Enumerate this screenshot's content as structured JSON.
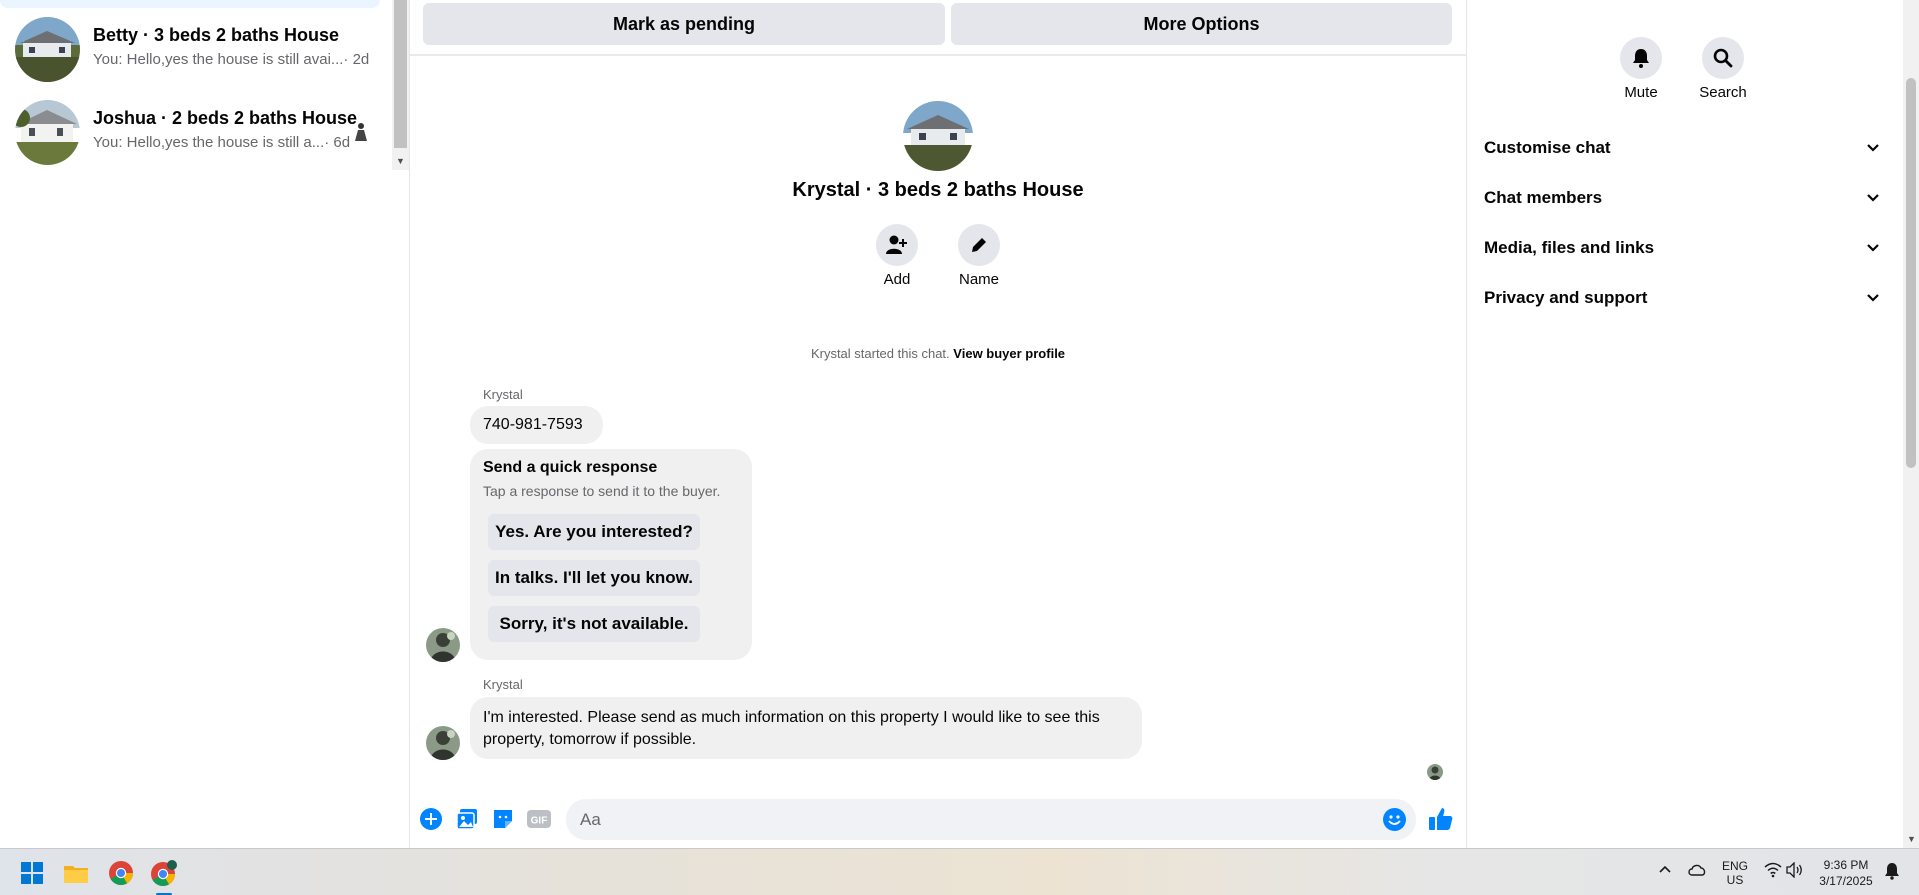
{
  "conversations": [
    {
      "title": "Betty · 3 beds 2 baths House",
      "preview": "You: Hello,yes the house is still avai...",
      "time": "· 2d"
    },
    {
      "title": "Joshua · 2 beds 2 baths House",
      "preview": "You: Hello,yes the house is still a...",
      "time": "· 6d"
    }
  ],
  "toolbar": {
    "pending_label": "Mark as pending",
    "more_label": "More Options"
  },
  "chat": {
    "title": "Krystal · 3 beds 2 baths House",
    "add_label": "Add",
    "name_label": "Name",
    "started_text": "Krystal started this chat.",
    "view_profile": "View buyer profile",
    "messages": [
      {
        "sender": "Krystal",
        "text": "740-981-7593"
      },
      {
        "sender": "Krystal",
        "text": "I'm interested. Please send as much information on this property I would like to see this property, tomorrow if possible."
      }
    ],
    "quick_response": {
      "title": "Send a quick response",
      "subtitle": "Tap a response to send it to the buyer.",
      "options": [
        "Yes. Are you interested?",
        "In talks. I'll let you know.",
        "Sorry, it's not available."
      ]
    }
  },
  "composer": {
    "placeholder": "Aa"
  },
  "right_panel": {
    "mute_label": "Mute",
    "search_label": "Search",
    "sections": [
      "Customise chat",
      "Chat members",
      "Media, files and links",
      "Privacy and support"
    ]
  },
  "taskbar": {
    "lang1": "ENG",
    "lang2": "US",
    "time": "9:36 PM",
    "date": "3/17/2025"
  },
  "colors": {
    "accent": "#0084ff",
    "bubble": "#f0f0f0",
    "button": "#e4e6eb",
    "muted_text": "#65676b"
  }
}
